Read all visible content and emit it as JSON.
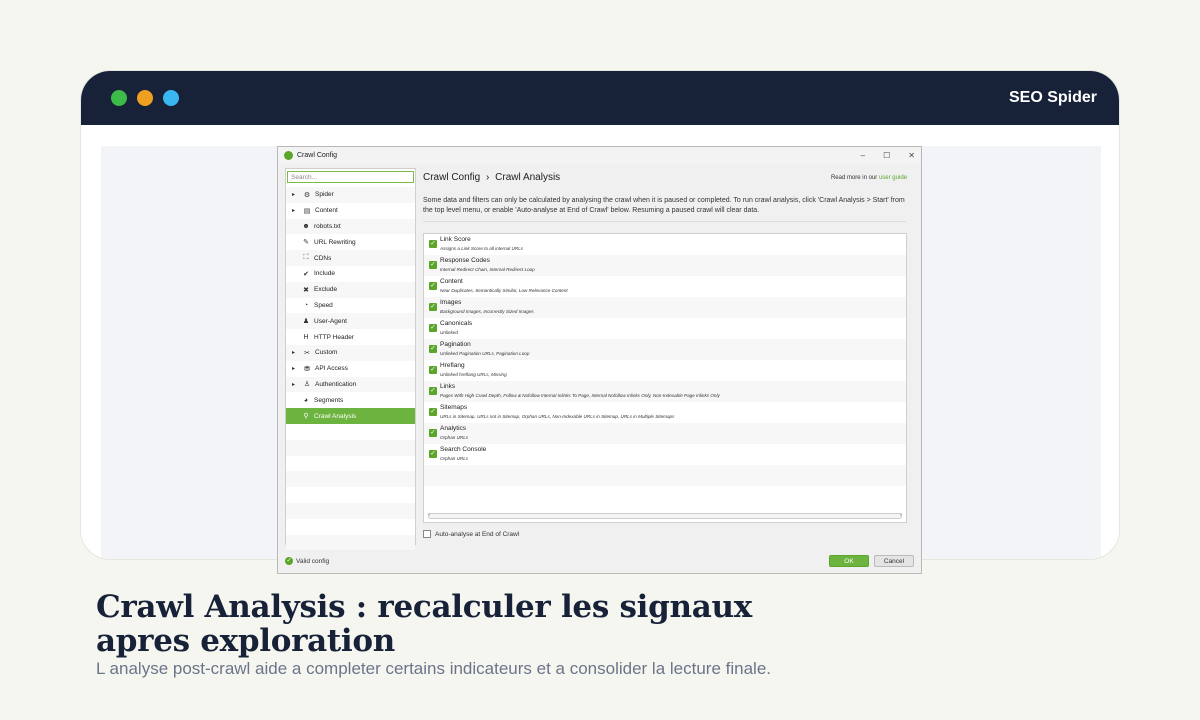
{
  "app": {
    "brand": "SEO Spider"
  },
  "colors": {
    "dark": "#172238",
    "accent": "#6cb33f",
    "dot1": "#3dbb4a",
    "dot2": "#f0a020",
    "dot3": "#3ab6f0"
  },
  "window": {
    "title": "Crawl Config",
    "controls": {
      "minimize": "–",
      "maximize": "☐",
      "close": "✕"
    },
    "search_placeholder": "Search...",
    "sidebar": [
      {
        "label": "Spider",
        "icon": "gear-icon",
        "glyph": "⚙",
        "expandable": true
      },
      {
        "label": "Content",
        "icon": "table-icon",
        "glyph": "▤",
        "expandable": true
      },
      {
        "label": "robots.txt",
        "icon": "robot-icon",
        "glyph": "☻",
        "expandable": false
      },
      {
        "label": "URL Rewriting",
        "icon": "edit-icon",
        "glyph": "✎",
        "expandable": false
      },
      {
        "label": "CDNs",
        "icon": "network-icon",
        "glyph": "⛶",
        "expandable": false
      },
      {
        "label": "Include",
        "icon": "check-circle-icon",
        "glyph": "✔",
        "expandable": false
      },
      {
        "label": "Exclude",
        "icon": "x-circle-icon",
        "glyph": "✖",
        "expandable": false
      },
      {
        "label": "Speed",
        "icon": "speedometer-icon",
        "glyph": "◔",
        "expandable": false
      },
      {
        "label": "User-Agent",
        "icon": "user-secret-icon",
        "glyph": "♟",
        "expandable": false
      },
      {
        "label": "HTTP Header",
        "icon": "header-icon",
        "glyph": "H",
        "expandable": false
      },
      {
        "label": "Custom",
        "icon": "tools-icon",
        "glyph": "✂",
        "expandable": true
      },
      {
        "label": "API Access",
        "icon": "api-icon",
        "glyph": "⛃",
        "expandable": true
      },
      {
        "label": "Authentication",
        "icon": "users-icon",
        "glyph": "♙",
        "expandable": true
      },
      {
        "label": "Segments",
        "icon": "pie-chart-icon",
        "glyph": "◕",
        "expandable": false
      },
      {
        "label": "Crawl Analysis",
        "icon": "search-icon",
        "glyph": "⚲",
        "expandable": false,
        "active": true
      }
    ],
    "breadcrumb": {
      "parent": "Crawl Config",
      "separator": "›",
      "current": "Crawl Analysis"
    },
    "read_more": {
      "text": "Read more in our",
      "link": "user guide"
    },
    "description": "Some data and filters can only be calculated by analysing the crawl when it is paused or completed. To run crawl analysis, click 'Crawl Analysis > Start' from the top level menu, or enable 'Auto-analyse at End of Crawl' below. Resuming a paused crawl will clear data.",
    "analyses": [
      {
        "name": "Link Score",
        "desc": "Assigns a Link Score to all internal URLs"
      },
      {
        "name": "Response Codes",
        "desc": "Internal Redirect Chain, Internal Redirect Loop"
      },
      {
        "name": "Content",
        "desc": "Near Duplicates, Semantically Similar, Low Relevance Content"
      },
      {
        "name": "Images",
        "desc": "Background Images, Incorrectly Sized Images"
      },
      {
        "name": "Canonicals",
        "desc": "Unlinked"
      },
      {
        "name": "Pagination",
        "desc": "Unlinked Pagination URLs, Pagination Loop"
      },
      {
        "name": "Hreflang",
        "desc": "Unlinked hreflang URLs, Missing"
      },
      {
        "name": "Links",
        "desc": "Pages With High Crawl Depth, Follow & Nofollow Internal Inlinks To Page, Internal Nofollow Inlinks Only, Non-Indexable Page Inlinks Only"
      },
      {
        "name": "Sitemaps",
        "desc": "URLs in Sitemap, URLs not in Sitemap, Orphan URLs, Non-Indexable URLs in Sitemap, URLs in Multiple Sitemaps"
      },
      {
        "name": "Analytics",
        "desc": "Orphan URLs"
      },
      {
        "name": "Search Console",
        "desc": "Orphan URLs"
      }
    ],
    "auto_analyse_label": "Auto-analyse at End of Crawl",
    "status": "Valid config",
    "ok_label": "OK",
    "cancel_label": "Cancel"
  },
  "caption": {
    "title": "Crawl Analysis : recalculer les signaux apres exploration",
    "subtitle": "L analyse post-crawl aide a completer certains indicateurs et a consolider la lecture finale."
  }
}
